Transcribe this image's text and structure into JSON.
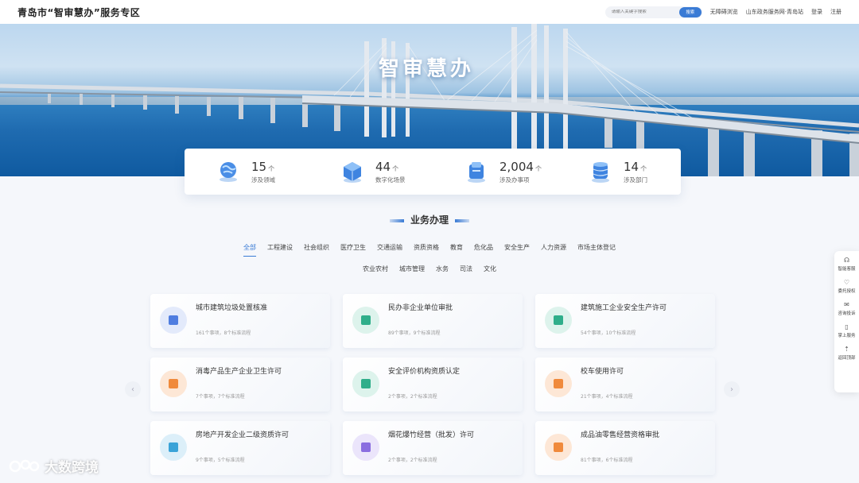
{
  "header": {
    "brand": "青岛市“智审慧办”服务专区",
    "search_placeholder": "请输入关键字搜索",
    "search_button": "搜索",
    "links": [
      "无障碍浏览",
      "山东政务服务网·青岛站",
      "登录",
      "注册"
    ]
  },
  "banner": {
    "title": "智审慧办"
  },
  "stats": [
    {
      "value": "15",
      "unit": "个",
      "label": "涉及领域",
      "icon": "globe-icon"
    },
    {
      "value": "44",
      "unit": "个",
      "label": "数字化场景",
      "icon": "cube-icon"
    },
    {
      "value": "2,004",
      "unit": "个",
      "label": "涉及办事项",
      "icon": "folder-icon"
    },
    {
      "value": "14",
      "unit": "个",
      "label": "涉及部门",
      "icon": "database-icon"
    }
  ],
  "section": {
    "title": "业务办理"
  },
  "categories_row1": [
    "全部",
    "工程建设",
    "社会组织",
    "医疗卫生",
    "交通运输",
    "资质资格",
    "教育",
    "危化品",
    "安全生产",
    "人力资源",
    "市场主体登记"
  ],
  "categories_row2": [
    "农业农村",
    "城市管理",
    "水务",
    "司法",
    "文化"
  ],
  "active_category": "全部",
  "cards": [
    {
      "title": "城市建筑垃圾处置核准",
      "meta": "161个事项，8个标准流程",
      "color": "#4f7de0",
      "bg": "#e3eafb"
    },
    {
      "title": "民办非企业单位审批",
      "meta": "89个事项，9个标准流程",
      "color": "#2fae8a",
      "bg": "#ddf3ec"
    },
    {
      "title": "建筑施工企业安全生产许可",
      "meta": "54个事项，10个标准流程",
      "color": "#2fae8a",
      "bg": "#ddf3ec"
    },
    {
      "title": "消毒产品生产企业卫生许可",
      "meta": "7个事项，7个标准流程",
      "color": "#f08a3c",
      "bg": "#fde7d6"
    },
    {
      "title": "安全评价机构资质认定",
      "meta": "2个事项，2个标准流程",
      "color": "#2fae8a",
      "bg": "#ddf3ec"
    },
    {
      "title": "校车使用许可",
      "meta": "21个事项，4个标准流程",
      "color": "#f08a3c",
      "bg": "#fde7d6"
    },
    {
      "title": "房地产开发企业二级资质许可",
      "meta": "9个事项，5个标准流程",
      "color": "#3aa3d8",
      "bg": "#dcefF9"
    },
    {
      "title": "烟花爆竹经营（批发）许可",
      "meta": "2个事项，2个标准流程",
      "color": "#8a6de0",
      "bg": "#ebe5fb"
    },
    {
      "title": "成品油零售经营资格审批",
      "meta": "81个事项，6个标准流程",
      "color": "#f08a3c",
      "bg": "#fde7d6"
    }
  ],
  "floatbar": [
    {
      "label": "智能客服",
      "icon": "headset-icon",
      "glyph": "☊"
    },
    {
      "label": "委托授权",
      "icon": "heart-icon",
      "glyph": "♡"
    },
    {
      "label": "咨询投诉",
      "icon": "mail-icon",
      "glyph": "✉"
    },
    {
      "label": "掌上服务",
      "icon": "phone-icon",
      "glyph": "▯"
    },
    {
      "label": "返回顶部",
      "icon": "arrow-up-icon",
      "glyph": "⇡"
    }
  ],
  "watermark": {
    "text": "大数跨境"
  }
}
